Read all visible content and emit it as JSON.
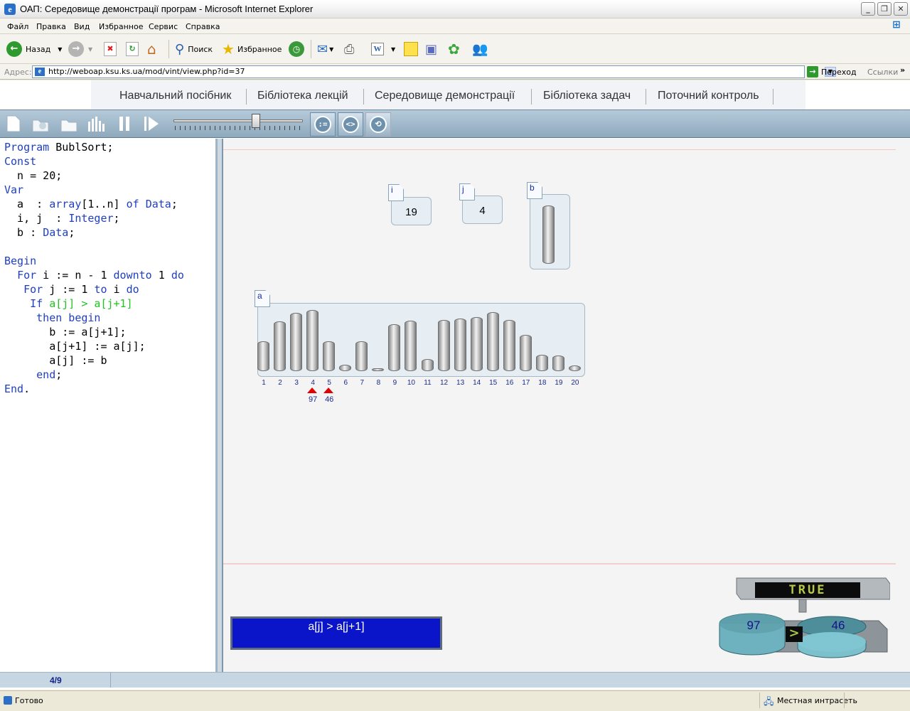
{
  "window": {
    "title": "ОАП: Середовище демонстрації програм - Microsoft Internet Explorer"
  },
  "menu": [
    "Файл",
    "Правка",
    "Вид",
    "Избранное",
    "Сервис",
    "Справка"
  ],
  "toolbar": {
    "back": "Назад",
    "search": "Поиск",
    "favorites": "Избранное"
  },
  "address": {
    "label": "Адрес:",
    "url": "http://weboap.ksu.ks.ua/mod/vint/view.php?id=37",
    "go": "Переход",
    "links": "Ссылки"
  },
  "nav": [
    "Навчальний посібник",
    "Бібліотека лекцій",
    "Середовище демонстрації",
    "Бібліотека задач",
    "Поточний контроль"
  ],
  "slider": {
    "position": 0.63
  },
  "code": [
    [
      {
        "t": "Program",
        "c": "kw"
      },
      {
        "t": " BublSort;",
        "c": ""
      }
    ],
    [
      {
        "t": "Const",
        "c": "kw"
      }
    ],
    [
      {
        "t": "  n = 20;",
        "c": ""
      }
    ],
    [
      {
        "t": "Var",
        "c": "kw"
      }
    ],
    [
      {
        "t": "  a  : ",
        "c": ""
      },
      {
        "t": "array",
        "c": "kw"
      },
      {
        "t": "[1..n] ",
        "c": ""
      },
      {
        "t": "of",
        "c": "kw"
      },
      {
        "t": " ",
        "c": ""
      },
      {
        "t": "Data",
        "c": "kw"
      },
      {
        "t": ";",
        "c": ""
      }
    ],
    [
      {
        "t": "  i, j  : ",
        "c": ""
      },
      {
        "t": "Integer",
        "c": "kw"
      },
      {
        "t": ";",
        "c": ""
      }
    ],
    [
      {
        "t": "  b : ",
        "c": ""
      },
      {
        "t": "Data",
        "c": "kw"
      },
      {
        "t": ";",
        "c": ""
      }
    ],
    [
      {
        "t": "",
        "c": ""
      }
    ],
    [
      {
        "t": "Begin",
        "c": "kw"
      }
    ],
    [
      {
        "t": "  ",
        "c": ""
      },
      {
        "t": "For",
        "c": "kw"
      },
      {
        "t": " i := n - 1 ",
        "c": ""
      },
      {
        "t": "downto",
        "c": "kw"
      },
      {
        "t": " 1 ",
        "c": ""
      },
      {
        "t": "do",
        "c": "kw"
      }
    ],
    [
      {
        "t": "   ",
        "c": ""
      },
      {
        "t": "For",
        "c": "kw"
      },
      {
        "t": " j := 1 ",
        "c": ""
      },
      {
        "t": "to",
        "c": "kw"
      },
      {
        "t": " i ",
        "c": ""
      },
      {
        "t": "do",
        "c": "kw"
      }
    ],
    [
      {
        "t": "    ",
        "c": ""
      },
      {
        "t": "If",
        "c": "kw"
      },
      {
        "t": " a[j] > a[j+1]",
        "c": "gr"
      }
    ],
    [
      {
        "t": "     ",
        "c": ""
      },
      {
        "t": "then begin",
        "c": "kw"
      }
    ],
    [
      {
        "t": "       b := a[j+1];",
        "c": ""
      }
    ],
    [
      {
        "t": "       a[j+1] := a[j];",
        "c": ""
      }
    ],
    [
      {
        "t": "       a[j] := b",
        "c": ""
      }
    ],
    [
      {
        "t": "     ",
        "c": ""
      },
      {
        "t": "end",
        "c": "kw"
      },
      {
        "t": ";",
        "c": ""
      }
    ],
    [
      {
        "t": "End",
        "c": "kw"
      },
      {
        "t": ".",
        "c": ""
      }
    ]
  ],
  "vars": {
    "i": {
      "label": "i",
      "value": "19"
    },
    "j": {
      "label": "j",
      "value": "4"
    },
    "b": {
      "label": "b"
    },
    "a": {
      "label": "a"
    }
  },
  "array": {
    "indices": [
      "1",
      "2",
      "3",
      "4",
      "5",
      "6",
      "7",
      "8",
      "9",
      "10",
      "11",
      "12",
      "13",
      "14",
      "15",
      "16",
      "17",
      "18",
      "19",
      "20"
    ],
    "heights": [
      0.49,
      0.81,
      0.95,
      1.0,
      0.49,
      0.11,
      0.49,
      0.04,
      0.77,
      0.83,
      0.2,
      0.84,
      0.86,
      0.88,
      0.97,
      0.84,
      0.59,
      0.27,
      0.25,
      0.09
    ],
    "pointers": [
      {
        "index": 4,
        "value": "97"
      },
      {
        "index": 5,
        "value": "46"
      }
    ]
  },
  "condition": {
    "text": "a[j] > a[j+1]"
  },
  "comparator": {
    "result": "TRUE",
    "left": "97",
    "op": ">",
    "right": "46"
  },
  "status": {
    "step": "4/9",
    "ready": "Готово",
    "zone": "Местная интрасеть"
  },
  "colors": {
    "keyword": "#1f3fc0",
    "highlight": "#22c322",
    "condition_bg": "#0a14c8",
    "pointer": "#e30000"
  }
}
